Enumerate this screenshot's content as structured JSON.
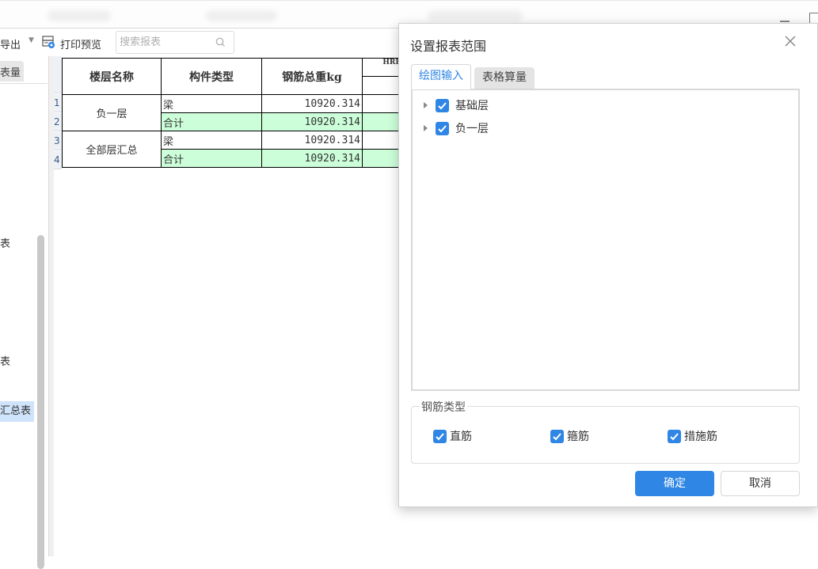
{
  "toolbar": {
    "export_label": "导出",
    "print_preview_label": "打印预览",
    "search_placeholder": "搜索报表"
  },
  "left_pane": {
    "tab_label": "表量",
    "items": [
      "表",
      "表",
      "汇总表"
    ]
  },
  "report": {
    "row_numbers": [
      "1",
      "2",
      "3",
      "4"
    ],
    "headers": {
      "floor": "楼层名称",
      "component": "构件类型",
      "total_weight": "钢筋总重kg",
      "hrb": "HRB"
    },
    "groups": [
      {
        "floor": "负一层",
        "rows": [
          {
            "component": "梁",
            "weight": "10920.314",
            "highlight": false
          },
          {
            "component": "合计",
            "weight": "10920.314",
            "highlight": true
          }
        ]
      },
      {
        "floor": "全部层汇总",
        "rows": [
          {
            "component": "梁",
            "weight": "10920.314",
            "highlight": false
          },
          {
            "component": "合计",
            "weight": "10920.314",
            "highlight": true
          }
        ]
      }
    ]
  },
  "dialog": {
    "title": "设置报表范围",
    "tabs": [
      {
        "label": "绘图输入",
        "active": true
      },
      {
        "label": "表格算量",
        "active": false
      }
    ],
    "tree": [
      {
        "label": "基础层",
        "checked": true
      },
      {
        "label": "负一层",
        "checked": true
      }
    ],
    "rebar_type": {
      "legend": "钢筋类型",
      "options": [
        {
          "label": "直筋",
          "checked": true
        },
        {
          "label": "箍筋",
          "checked": true
        },
        {
          "label": "措施筋",
          "checked": true
        }
      ]
    },
    "ok_label": "确定",
    "cancel_label": "取消"
  },
  "colors": {
    "accent": "#2f86e4",
    "highlight_row": "#ccffd9",
    "selection": "#cfe3fb"
  }
}
